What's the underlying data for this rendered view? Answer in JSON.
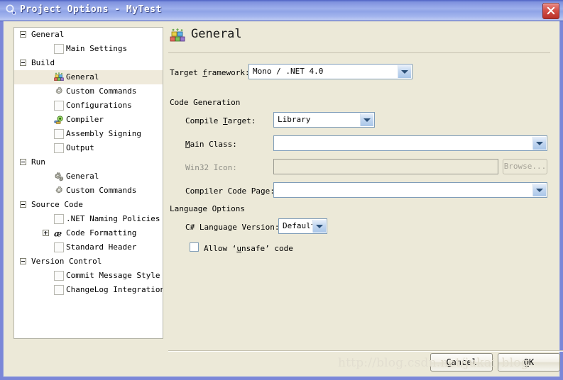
{
  "window": {
    "title": "Project Options - MyTest",
    "title_icon": "options-wrench-icon",
    "close_label": "x",
    "accent_titlebar": "#9eb0ec",
    "client_bg": "#ece9d8",
    "close_button_color": "#c4392f"
  },
  "sidebar": {
    "items": [
      {
        "label": "General",
        "icon": "none",
        "level": 0,
        "expander": "minus",
        "selected": false
      },
      {
        "label": "Main Settings",
        "icon": "blank-page-icon",
        "level": 1,
        "expander": "none",
        "selected": false
      },
      {
        "label": "Build",
        "icon": "none",
        "level": 0,
        "expander": "minus",
        "selected": false
      },
      {
        "label": "General",
        "icon": "bricks-icon",
        "level": 1,
        "expander": "none",
        "selected": true
      },
      {
        "label": "Custom Commands",
        "icon": "gear-icon",
        "level": 1,
        "expander": "none",
        "selected": false
      },
      {
        "label": "Configurations",
        "icon": "blank-page-icon",
        "level": 1,
        "expander": "none",
        "selected": false
      },
      {
        "label": "Compiler",
        "icon": "compiler-icon",
        "level": 1,
        "expander": "none",
        "selected": false
      },
      {
        "label": "Assembly Signing",
        "icon": "blank-page-icon",
        "level": 1,
        "expander": "none",
        "selected": false
      },
      {
        "label": "Output",
        "icon": "blank-page-icon",
        "level": 1,
        "expander": "none",
        "selected": false
      },
      {
        "label": "Run",
        "icon": "none",
        "level": 0,
        "expander": "minus",
        "selected": false
      },
      {
        "label": "General",
        "icon": "gears-icon",
        "level": 1,
        "expander": "none",
        "selected": false
      },
      {
        "label": "Custom Commands",
        "icon": "gear-icon",
        "level": 1,
        "expander": "none",
        "selected": false
      },
      {
        "label": "Source Code",
        "icon": "none",
        "level": 0,
        "expander": "minus",
        "selected": false
      },
      {
        "label": ".NET Naming Policies",
        "icon": "blank-page-icon",
        "level": 1,
        "expander": "none",
        "selected": false
      },
      {
        "label": "Code Formatting",
        "icon": "code-format-icon",
        "level": 1,
        "expander": "plus",
        "selected": false
      },
      {
        "label": "Standard Header",
        "icon": "blank-page-icon",
        "level": 1,
        "expander": "none",
        "selected": false
      },
      {
        "label": "Version Control",
        "icon": "none",
        "level": 0,
        "expander": "minus",
        "selected": false
      },
      {
        "label": "Commit Message Style",
        "icon": "blank-page-icon",
        "level": 1,
        "expander": "none",
        "selected": false
      },
      {
        "label": "ChangeLog Integration",
        "icon": "blank-page-icon",
        "level": 1,
        "expander": "none",
        "selected": false
      }
    ]
  },
  "main": {
    "header_title": "General",
    "header_icon": "bricks-icon",
    "target_framework": {
      "label_pre": "Target ",
      "label_mnemonic": "f",
      "label_post": "ramework:",
      "value": "Mono / .NET 4.0"
    },
    "code_generation": {
      "group_title": "Code Generation",
      "compile_target": {
        "label_pre": "Compile ",
        "label_mnemonic": "T",
        "label_post": "arget:",
        "value": "Library"
      },
      "main_class": {
        "label_pre": "",
        "label_mnemonic": "M",
        "label_post": "ain Class:",
        "value": ""
      },
      "win32_icon": {
        "label_pre": "Win32 Icon:",
        "label_mnemonic": "",
        "label_post": "",
        "value": "",
        "browse_label": "Browse..."
      },
      "compiler_code_page": {
        "label_pre": "Compiler Code Page:",
        "label_mnemonic": "",
        "label_post": "",
        "value": ""
      }
    },
    "language_options": {
      "group_title": "Language Options",
      "csharp_version": {
        "label_pre": "C# Language Version:",
        "label_mnemonic": "",
        "label_post": "",
        "value": "Default"
      },
      "allow_unsafe": {
        "label_pre": "Allow ‘",
        "label_mnemonic": "u",
        "label_post": "nsafe’ code",
        "checked": false
      }
    }
  },
  "footer": {
    "cancel": {
      "pre": "",
      "mnemonic": "C",
      "post": "ancel"
    },
    "ok": {
      "pre": "",
      "mnemonic": "O",
      "post": "K"
    },
    "watermark": "http://blog.csdn.net/jukai_blog"
  }
}
